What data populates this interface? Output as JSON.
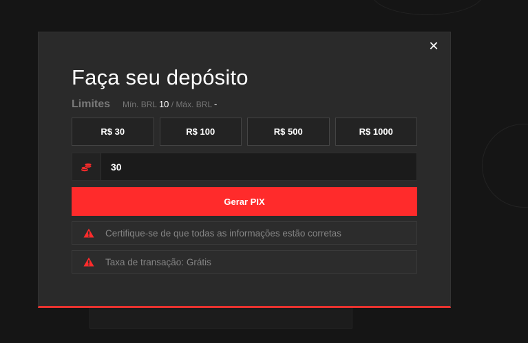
{
  "modal": {
    "title": "Faça seu depósito",
    "close_glyph": "✕",
    "limits": {
      "label": "Limites",
      "min_label": "Mín. BRL",
      "min_value": "10",
      "separator": "/",
      "max_label": "Máx. BRL",
      "max_value": "-"
    },
    "quick_amounts": [
      "R$ 30",
      "R$ 100",
      "R$ 500",
      "R$ 1000"
    ],
    "amount_input": {
      "value": "30",
      "icon": "coins-icon"
    },
    "submit_label": "Gerar PIX",
    "notices": [
      {
        "icon": "warning-icon",
        "text": "Certifique-se de que todas as informações estão corretas"
      },
      {
        "icon": "warning-icon",
        "text": "Taxa de transação: Grátis"
      }
    ]
  },
  "colors": {
    "accent": "#ff2b2b",
    "modal_bg": "#2a2a2a",
    "page_bg": "#151515"
  }
}
